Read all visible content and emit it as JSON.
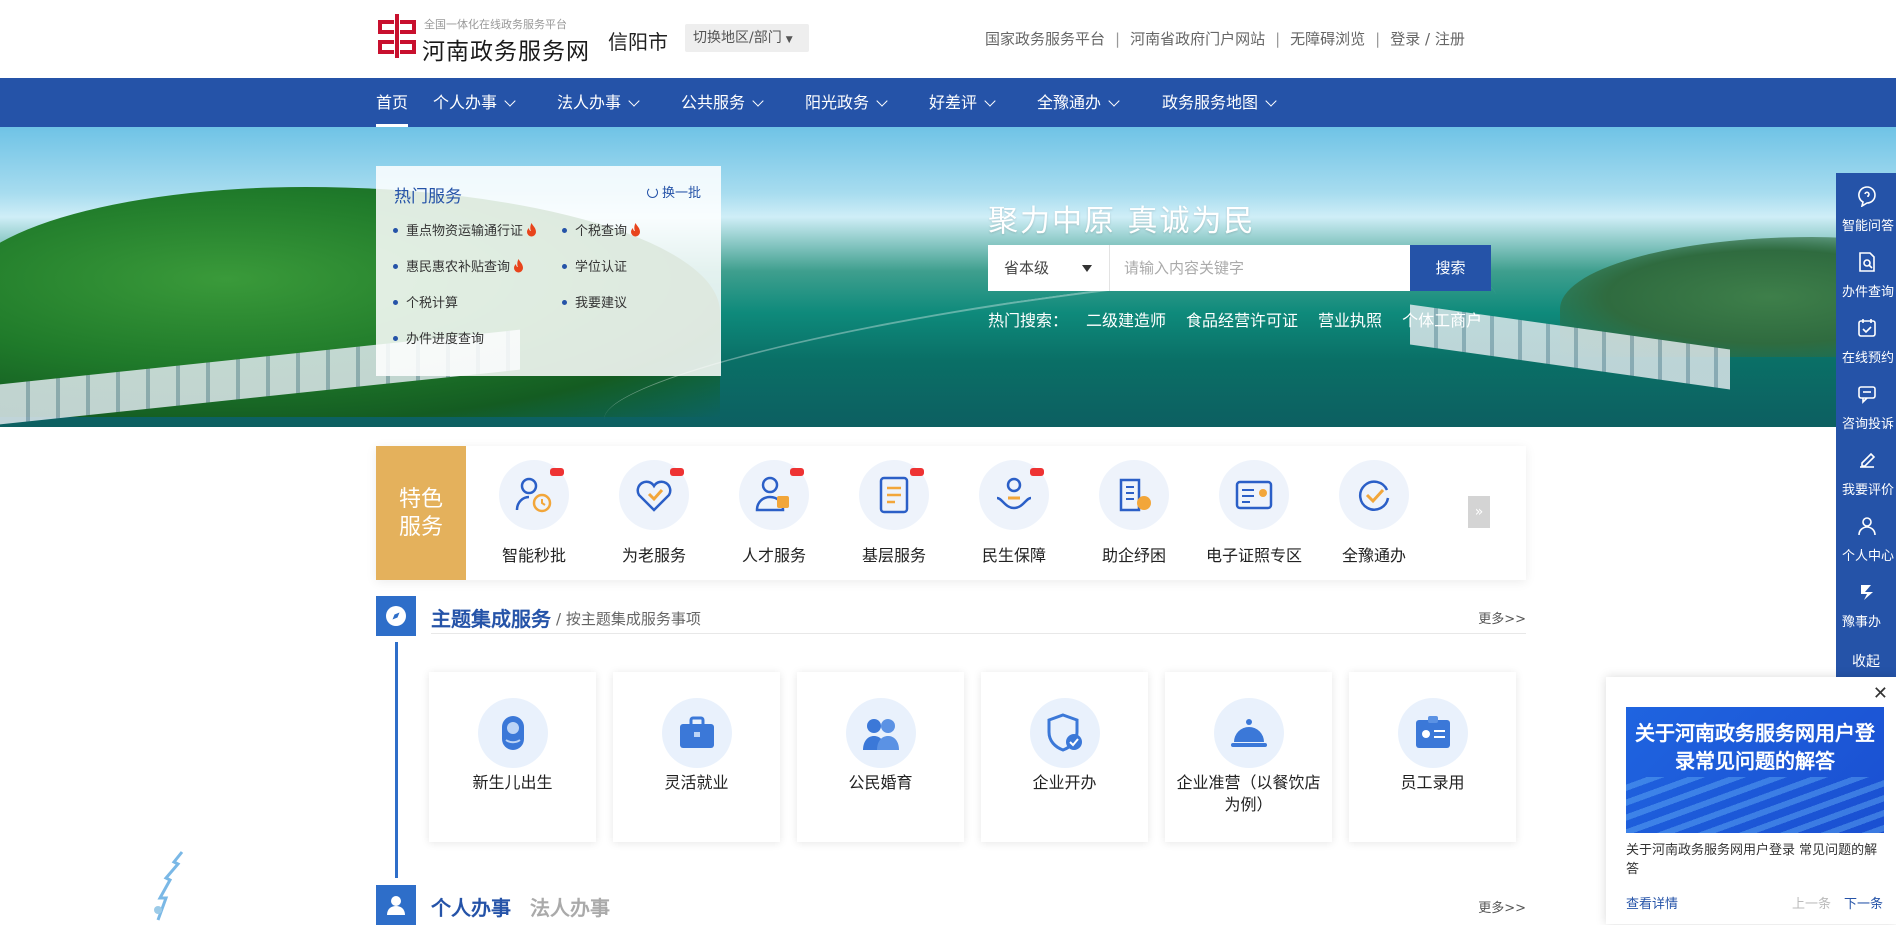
{
  "header": {
    "logo_sub": "全国一体化在线政务服务平台",
    "logo_name": "河南政务服务网",
    "city": "信阳市",
    "switch_label": "切换地区/部门",
    "links": [
      "国家政务服务平台",
      "河南省政府门户网站",
      "无障碍浏览",
      "登录 / 注册"
    ]
  },
  "nav": {
    "items": [
      {
        "label": "首页"
      },
      {
        "label": "个人办事"
      },
      {
        "label": "法人办事"
      },
      {
        "label": "公共服务"
      },
      {
        "label": "阳光政务"
      },
      {
        "label": "好差评"
      },
      {
        "label": "全豫通办"
      },
      {
        "label": "政务服务地图"
      }
    ]
  },
  "hot": {
    "title": "热门服务",
    "refresh": "换一批",
    "items": [
      "重点物资运输通行证",
      "个税查询",
      "惠民惠农补贴查询",
      "学位认证",
      "个税计算",
      "我要建议",
      "办件进度查询"
    ]
  },
  "search": {
    "slogan": "聚力中原  真诚为民",
    "level": "省本级",
    "placeholder": "请输入内容关键字",
    "button": "搜索",
    "hot_label": "热门搜索：",
    "keywords": [
      "二级建造师",
      "食品经营许可证",
      "营业执照",
      "个体工商户"
    ]
  },
  "feature": {
    "label_line1": "特色",
    "label_line2": "服务",
    "items": [
      "智能秒批",
      "为老服务",
      "人才服务",
      "基层服务",
      "民生保障",
      "助企纾困",
      "电子证照专区",
      "全豫通办"
    ],
    "next_icon": "»"
  },
  "theme": {
    "title": "主题集成服务",
    "desc": "/ 按主题集成服务事项",
    "more": "更多>>",
    "cards": [
      "新生儿出生",
      "灵活就业",
      "公民婚育",
      "企业开办",
      "企业准营（以餐饮店为例）",
      "员工录用"
    ]
  },
  "personal": {
    "tab1": "个人办事",
    "tab2": "法人办事",
    "more": "更多>>"
  },
  "sidebar": {
    "items": [
      "智能问答",
      "办件查询",
      "在线预约",
      "咨询投诉",
      "我要评价",
      "个人中心",
      "豫事办"
    ],
    "collapse": "收起"
  },
  "popup": {
    "close": "✕",
    "image_text": "关于河南政务服务网用户登录常见问题的解答",
    "caption": "关于河南政务服务网用户登录 常见问题的解答",
    "link": "查看详情",
    "prev": "上一条",
    "next": "下一条"
  },
  "colors": {
    "primary": "#2553a8",
    "accent": "#e4b15c",
    "new_badge": "#e33"
  }
}
